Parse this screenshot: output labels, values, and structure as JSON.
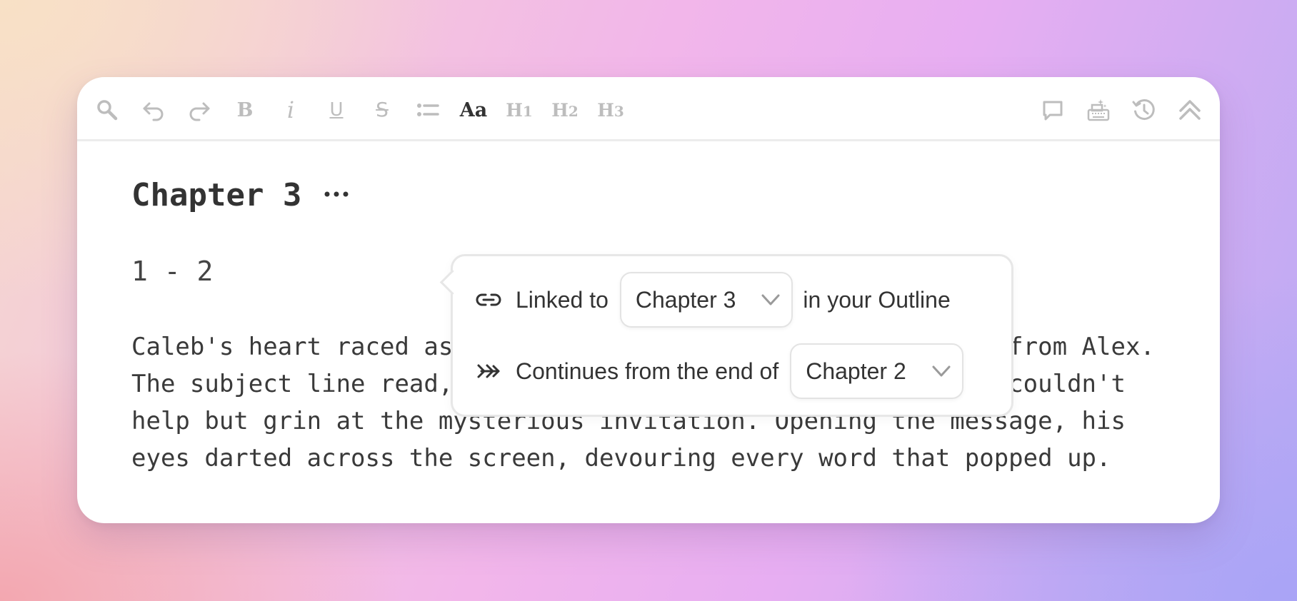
{
  "toolbar": {
    "bold": "B",
    "italic": "i",
    "underline": "U",
    "strike": "S",
    "font": "Aa",
    "h1": "H",
    "h1_num": "1",
    "h2": "H",
    "h2_num": "2",
    "h3": "H",
    "h3_num": "3"
  },
  "chapter": {
    "title": "Chapter 3",
    "range": "1 - 2"
  },
  "popover": {
    "linked_label": "Linked to",
    "linked_value": "Chapter 3",
    "linked_suffix": "in your Outline",
    "continues_label": "Continues from the end of",
    "continues_value": "Chapter 2"
  },
  "body": {
    "text": "Caleb's heart raced as he clicked on the email notification from Alex. The subject line read, \"The Midnight Gambit awaits you.\" He couldn't help but grin at the mysterious invitation. Opening the message, his eyes darted across the screen, devouring every word that popped up."
  },
  "colors": {
    "icon_muted": "#bdbdbd",
    "text": "#333333"
  }
}
